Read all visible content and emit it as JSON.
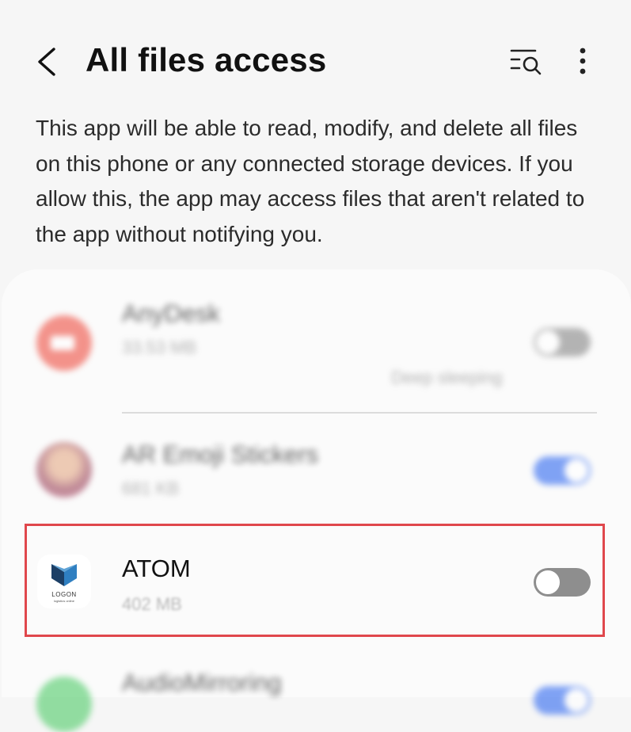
{
  "header": {
    "title": "All files access",
    "back_icon": "chevron-left-icon",
    "search_icon": "list-search-icon",
    "more_icon": "more-vertical-icon"
  },
  "description": "This app will be able to read, modify, and delete all files on this phone or any connected storage devices. If you allow this, the app may access files that aren't related to the app without notifying you.",
  "apps": [
    {
      "name": "AnyDesk",
      "size": "33.53 MB",
      "status": "Deep sleeping",
      "enabled": false,
      "icon": "anydesk-icon",
      "icon_color": "#ef5b4f"
    },
    {
      "name": "AR Emoji Stickers",
      "size": "681 KB",
      "enabled": true,
      "icon": "ar-emoji-icon"
    },
    {
      "name": "ATOM",
      "size": "402 MB",
      "enabled": false,
      "icon": "logon-icon",
      "icon_text": "LOGON",
      "icon_subtext": "logistics online"
    },
    {
      "name": "AudioMirroring",
      "enabled": true,
      "icon": "audio-mirroring-icon",
      "icon_color": "#5ccf73"
    }
  ],
  "colors": {
    "toggle_on": "#3e73f1",
    "toggle_off": "#8e8e8e",
    "highlight": "#e0474c"
  }
}
